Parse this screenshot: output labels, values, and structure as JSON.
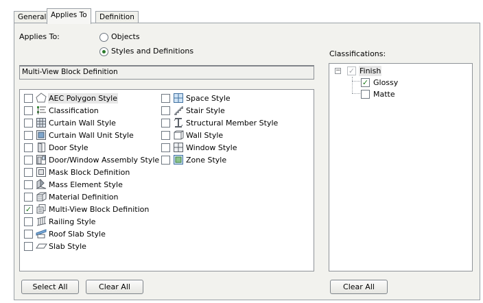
{
  "tabs": [
    "General",
    "Applies To",
    "Definition"
  ],
  "applies_to": {
    "label": "Applies To:",
    "options": [
      "Objects",
      "Styles and Definitions"
    ],
    "selected": "Styles and Definitions"
  },
  "current_definition": "Multi-View Block Definition",
  "styles_list": {
    "column1": [
      {
        "label": "AEC Polygon Style",
        "checked": false,
        "icon": "polygon-icon"
      },
      {
        "label": "Classification",
        "checked": false,
        "icon": "classification-icon"
      },
      {
        "label": "Curtain Wall Style",
        "checked": false,
        "icon": "curtain-wall-icon"
      },
      {
        "label": "Curtain Wall Unit Style",
        "checked": false,
        "icon": "curtain-wall-unit-icon"
      },
      {
        "label": "Door Style",
        "checked": false,
        "icon": "door-icon"
      },
      {
        "label": "Door/Window Assembly Style",
        "checked": false,
        "icon": "door-window-assembly-icon"
      },
      {
        "label": "Mask Block Definition",
        "checked": false,
        "icon": "mask-block-icon"
      },
      {
        "label": "Mass Element Style",
        "checked": false,
        "icon": "mass-element-icon"
      },
      {
        "label": "Material Definition",
        "checked": false,
        "icon": "material-icon"
      },
      {
        "label": "Multi-View Block Definition",
        "checked": true,
        "icon": "multi-view-block-icon"
      },
      {
        "label": "Railing Style",
        "checked": false,
        "icon": "railing-icon"
      },
      {
        "label": "Roof Slab Style",
        "checked": false,
        "icon": "roof-slab-icon"
      },
      {
        "label": "Slab Style",
        "checked": false,
        "icon": "slab-icon"
      }
    ],
    "column2": [
      {
        "label": "Space Style",
        "checked": false,
        "icon": "space-icon"
      },
      {
        "label": "Stair Style",
        "checked": false,
        "icon": "stair-icon"
      },
      {
        "label": "Structural Member Style",
        "checked": false,
        "icon": "structural-member-icon"
      },
      {
        "label": "Wall Style",
        "checked": false,
        "icon": "wall-icon"
      },
      {
        "label": "Window Style",
        "checked": false,
        "icon": "window-icon"
      },
      {
        "label": "Zone Style",
        "checked": false,
        "icon": "zone-icon"
      }
    ]
  },
  "classifications": {
    "label": "Classifications:",
    "root": {
      "label": "Finish",
      "checked": true,
      "expanded": true
    },
    "children": [
      {
        "label": "Glossy",
        "checked": true
      },
      {
        "label": "Matte",
        "checked": false
      }
    ]
  },
  "buttons": {
    "select_all": "Select All",
    "clear_all_left": "Clear All",
    "clear_all_right": "Clear All"
  },
  "colors": {
    "check": "#1e7d1e",
    "panel_bg": "#f2f2ee",
    "border": "#8e9297"
  }
}
